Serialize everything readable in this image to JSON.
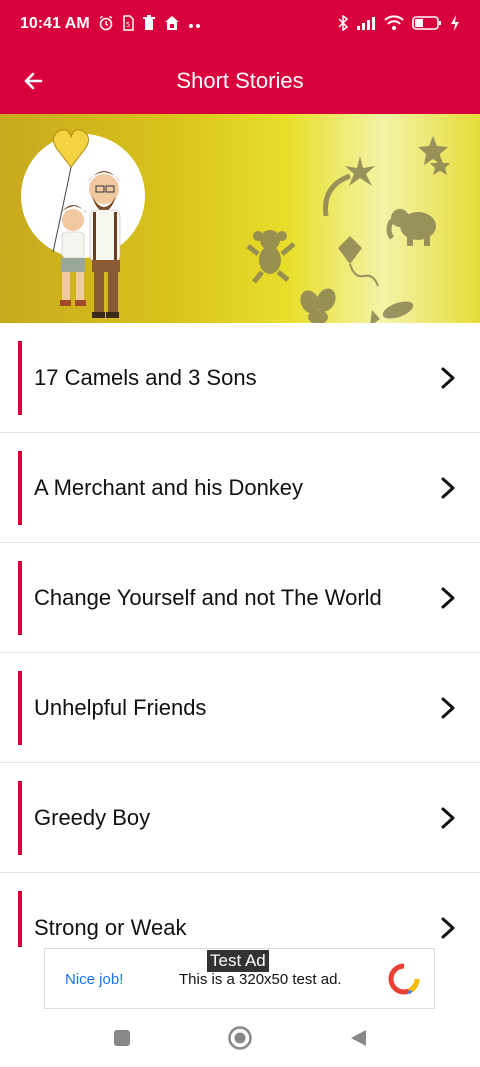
{
  "status_bar": {
    "time": "10:41 AM",
    "left_icons": [
      "alarm-icon",
      "sim-icon",
      "delete-icon",
      "home-icon",
      "more-dots-icon"
    ],
    "right_icons": [
      "bluetooth-icon",
      "signal-icon",
      "wifi-icon",
      "battery-icon",
      "charging-icon"
    ],
    "battery_level": "33"
  },
  "app_bar": {
    "title": "Short Stories",
    "back_icon": "arrow-back-icon",
    "color": "#d8003d"
  },
  "banner": {
    "illustration": "father-and-child-with-balloon",
    "decorations": [
      "monkey-icon",
      "elephant-icon",
      "kite-icon",
      "butterfly-icon",
      "fish-icon",
      "stars-icon",
      "comet-icon"
    ]
  },
  "stories": [
    {
      "title": "17 Camels and 3 Sons"
    },
    {
      "title": "A Merchant and his Donkey"
    },
    {
      "title": "Change Yourself and not The World"
    },
    {
      "title": "Unhelpful Friends"
    },
    {
      "title": "Greedy Boy"
    },
    {
      "title": "Strong or Weak"
    }
  ],
  "ad": {
    "label": "Test Ad",
    "nice": "Nice job!",
    "text": "This is a 320x50 test ad."
  },
  "nav_bar": {
    "buttons": [
      "recents-icon",
      "home-circle-icon",
      "back-triangle-icon"
    ]
  }
}
